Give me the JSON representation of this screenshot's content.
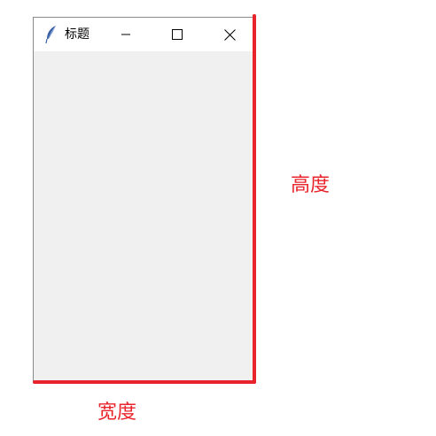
{
  "window": {
    "title": "标题",
    "app_icon": "feather-icon",
    "controls": {
      "minimize_icon": "minimize-icon",
      "maximize_icon": "maximize-icon",
      "close_icon": "close-icon"
    },
    "client_color": "#f0f0f0"
  },
  "annotations": {
    "height_label": "高度",
    "width_label": "宽度",
    "color": "#e8232b"
  }
}
